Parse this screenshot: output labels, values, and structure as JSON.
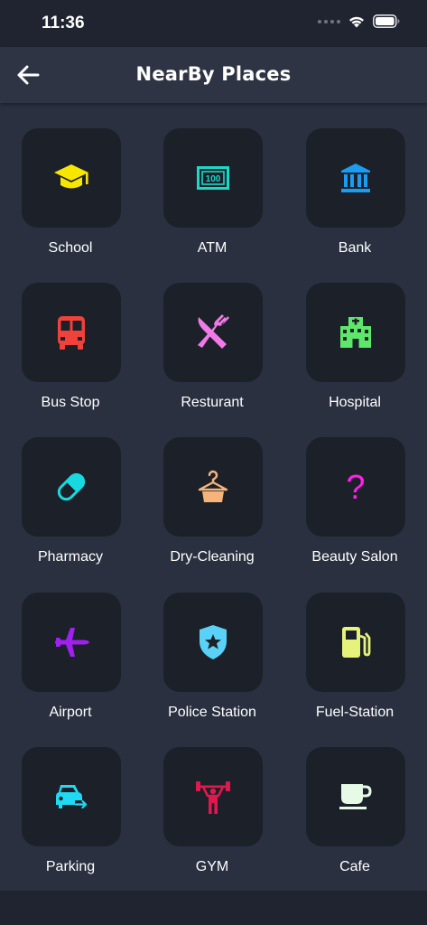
{
  "status_bar": {
    "time": "11:36"
  },
  "header": {
    "title": "NearBy Places"
  },
  "places": [
    {
      "label": "School",
      "icon": "graduation-cap-icon",
      "color": "#f7e600"
    },
    {
      "label": "ATM",
      "icon": "money-bill-icon",
      "color": "#19d9c8"
    },
    {
      "label": "Bank",
      "icon": "bank-icon",
      "color": "#1a9cf2"
    },
    {
      "label": "Bus Stop",
      "icon": "bus-icon",
      "color": "#f0413b"
    },
    {
      "label": "Resturant",
      "icon": "utensils-icon",
      "color": "#f07ae6"
    },
    {
      "label": "Hospital",
      "icon": "hospital-icon",
      "color": "#5ee86b"
    },
    {
      "label": "Pharmacy",
      "icon": "pill-icon",
      "color": "#18d9e0"
    },
    {
      "label": "Dry-Cleaning",
      "icon": "hanger-icon",
      "color": "#f5b47a"
    },
    {
      "label": "Beauty Salon",
      "icon": "question-icon",
      "color": "#ff1fe6"
    },
    {
      "label": "Airport",
      "icon": "plane-icon",
      "color": "#a020f0"
    },
    {
      "label": "Police Station",
      "icon": "police-shield-icon",
      "color": "#5ad2f7"
    },
    {
      "label": "Fuel-Station",
      "icon": "fuel-pump-icon",
      "color": "#e6f27a"
    },
    {
      "label": "Parking",
      "icon": "parking-car-icon",
      "color": "#20d9f2"
    },
    {
      "label": "GYM",
      "icon": "weightlifter-icon",
      "color": "#e0184e"
    },
    {
      "label": "Cafe",
      "icon": "coffee-cup-icon",
      "color": "#e6fae6"
    }
  ]
}
